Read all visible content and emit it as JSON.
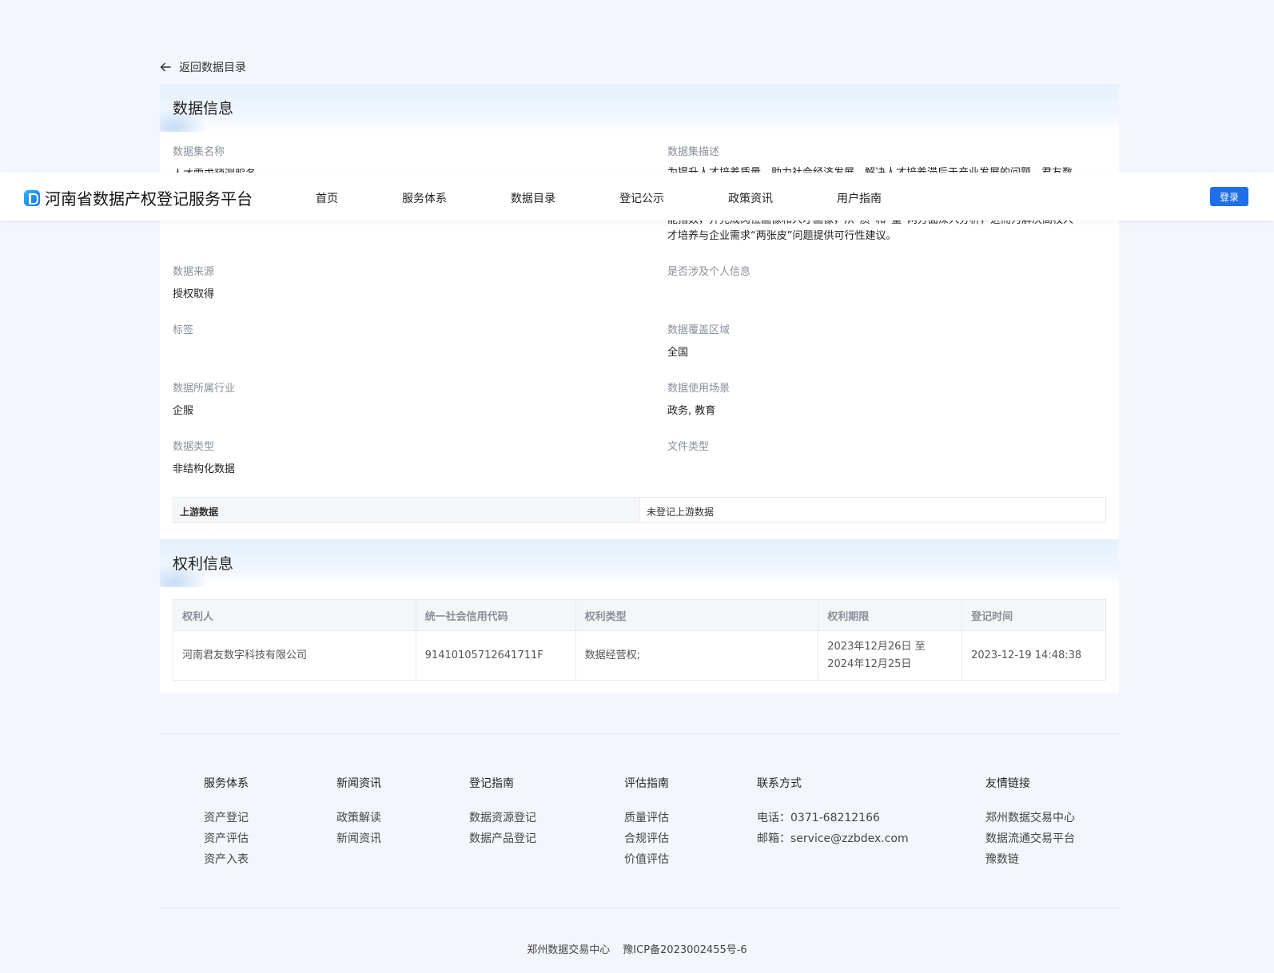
{
  "back": {
    "label": "返回数据目录"
  },
  "data_info": {
    "title": "数据信息",
    "fields": {
      "dataset_name": {
        "label": "数据集名称",
        "value": "人才需求预测服务"
      },
      "dataset_desc": {
        "label": "数据集描述",
        "value_line1": "为提升人才培养质量，助力社会经济发展，解决人才培养滞后于产业发展的问题，君友数",
        "value_line2": "能指数，并完成岗位画像和人才画像，从“质”和“量”两方面深入分析，进而为解决高校人",
        "value_line3": "才培养与企业需求“两张皮”问题提供可行性建议。"
      },
      "source": {
        "label": "数据来源",
        "value": "授权取得"
      },
      "personal_info": {
        "label": "是否涉及个人信息",
        "value": ""
      },
      "tags": {
        "label": "标签",
        "value": ""
      },
      "coverage": {
        "label": "数据覆盖区域",
        "value": "全国"
      },
      "industry": {
        "label": "数据所属行业",
        "value": "企服"
      },
      "scenario": {
        "label": "数据使用场景",
        "value": "政务, 教育"
      },
      "data_type": {
        "label": "数据类型",
        "value": "非结构化数据"
      },
      "file_type": {
        "label": "文件类型",
        "value": ""
      }
    },
    "upstream": {
      "label": "上游数据",
      "value": "未登记上游数据"
    }
  },
  "rights_info": {
    "title": "权利信息",
    "columns": [
      "权利人",
      "统一社会信用代码",
      "权利类型",
      "权利期限",
      "登记时间"
    ],
    "rows": [
      {
        "holder": "河南君友数字科技有限公司",
        "credit_code": "91410105712641711F",
        "right_type": "数据经营权;",
        "period_line1": "2023年12月26日 至",
        "period_line2": "2024年12月25日",
        "registered_at": "2023-12-19 14:48:38"
      }
    ]
  },
  "header": {
    "brand": "河南省数据产权登记服务平台",
    "nav": [
      "首页",
      "服务体系",
      "数据目录",
      "登记公示",
      "政策资讯",
      "用户指南"
    ],
    "login": "登录"
  },
  "footer": {
    "columns": [
      {
        "title": "服务体系",
        "items": [
          "资产登记",
          "资产评估",
          "资产入表"
        ]
      },
      {
        "title": "新闻资讯",
        "items": [
          "政策解读",
          "新闻资讯"
        ]
      },
      {
        "title": "登记指南",
        "items": [
          "数据资源登记",
          "数据产品登记"
        ]
      },
      {
        "title": "评估指南",
        "items": [
          "质量评估",
          "合规评估",
          "价值评估"
        ]
      },
      {
        "title": "联系方式",
        "items": [
          "电话：0371-68212166",
          "邮箱：service@zzbdex.com"
        ]
      },
      {
        "title": "友情链接",
        "items": [
          "郑州数据交易中心",
          "数据流通交易平台",
          "豫数链"
        ]
      }
    ],
    "copyright_org": "郑州数据交易中心",
    "icp": "豫ICP备2023002455号-6"
  },
  "colors": {
    "accent": "#1f6fe8",
    "page_bg": "#f3f6fb"
  }
}
